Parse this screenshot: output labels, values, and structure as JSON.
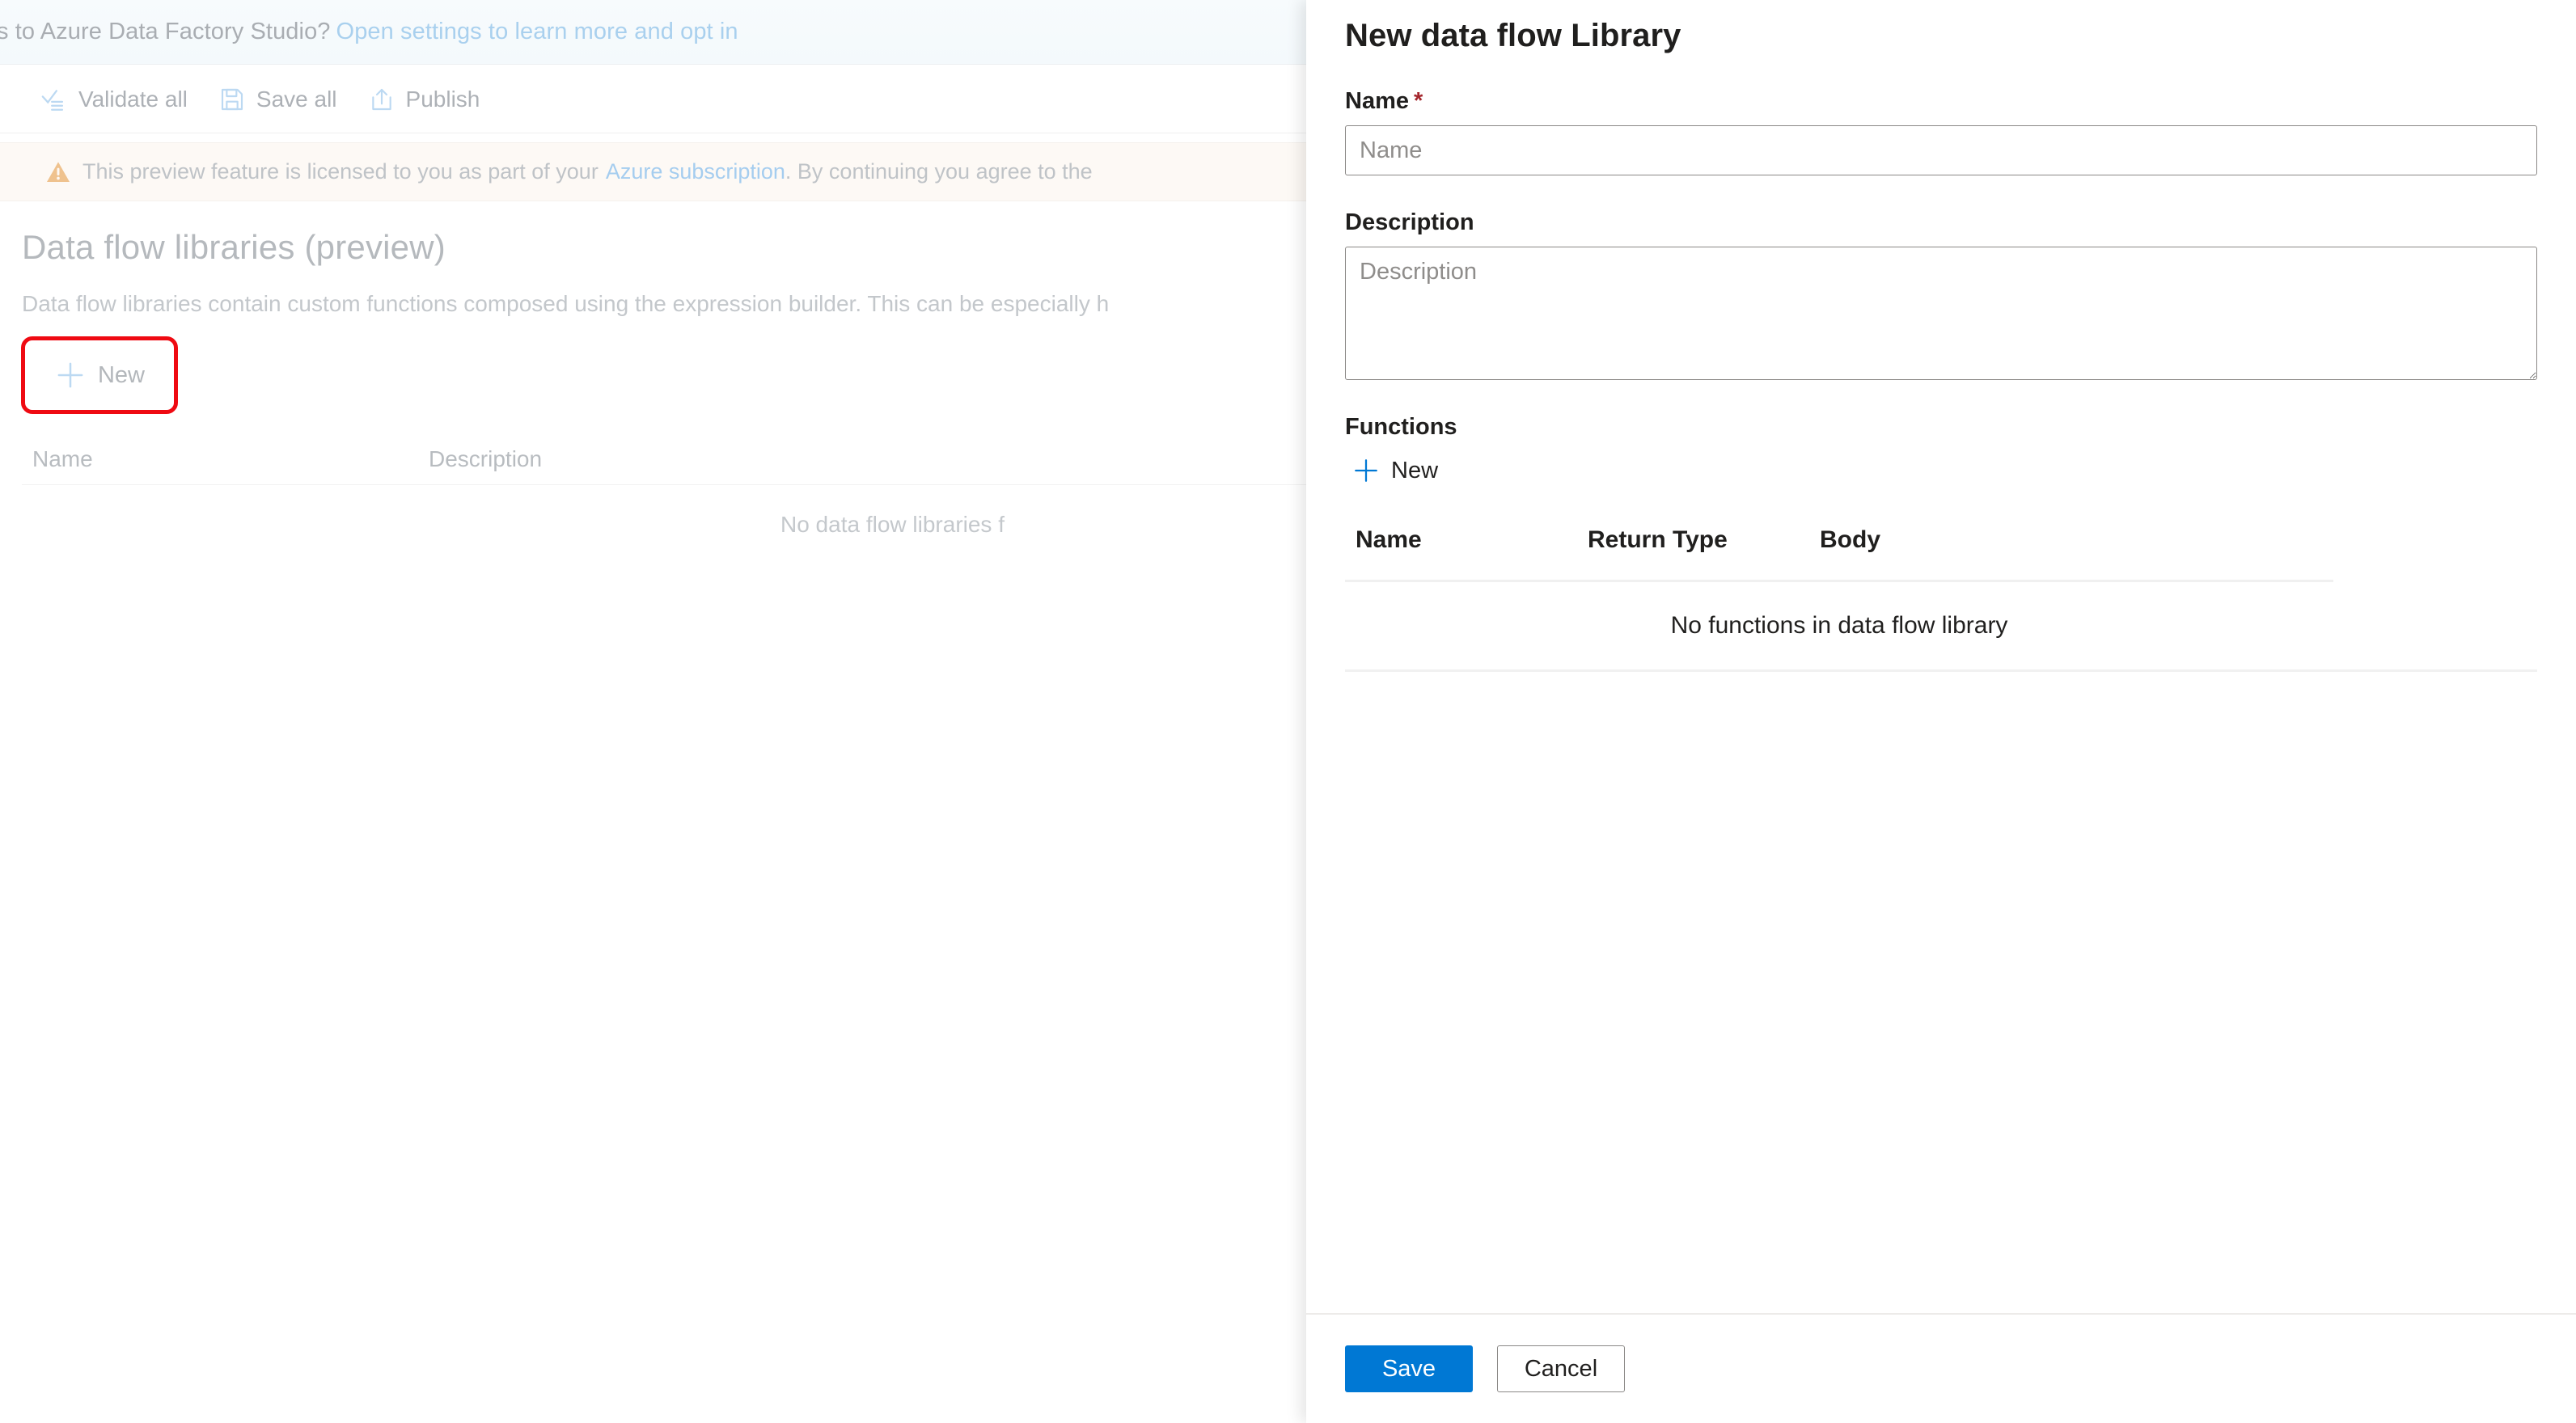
{
  "colors": {
    "accent": "#0078d4",
    "highlight_box": "#ef0a12",
    "required_star": "#a4262c",
    "warning_icon": "#efc28e",
    "muted_text": "#b8bcc0",
    "link_faded": "#a5cdef"
  },
  "studio": {
    "optin_banner": {
      "text": "s to Azure Data Factory Studio?",
      "link": "Open settings to learn more and opt in"
    },
    "commandbar": [
      {
        "icon": "validate-all-icon",
        "label": "Validate all"
      },
      {
        "icon": "save-all-icon",
        "label": "Save all"
      },
      {
        "icon": "publish-icon",
        "label": "Publish"
      }
    ],
    "preview_strip": {
      "icon": "warning-icon",
      "text_before": "This preview feature is licensed to you as part of your",
      "link": "Azure subscription",
      "text_after": ". By continuing you agree to the"
    },
    "page": {
      "title": "Data flow libraries (preview)",
      "description": "Data flow libraries contain custom functions composed using the expression builder. This can be especially h",
      "new_button": {
        "icon": "plus-icon",
        "label": "New"
      },
      "table": {
        "columns": [
          "Name",
          "Description"
        ],
        "rows": [],
        "empty_message": "No data flow libraries f"
      }
    }
  },
  "panel": {
    "title": "New data flow Library",
    "name_field": {
      "label": "Name",
      "required_marker": "*",
      "value": "",
      "placeholder": "Name"
    },
    "description_field": {
      "label": "Description",
      "value": "",
      "placeholder": "Description"
    },
    "functions": {
      "label": "Functions",
      "new_button": {
        "icon": "plus-icon",
        "label": "New"
      },
      "columns": [
        "Name",
        "Return Type",
        "Body"
      ],
      "rows": [],
      "empty_message": "No functions in data flow library"
    },
    "footer": {
      "save_label": "Save",
      "cancel_label": "Cancel"
    }
  }
}
